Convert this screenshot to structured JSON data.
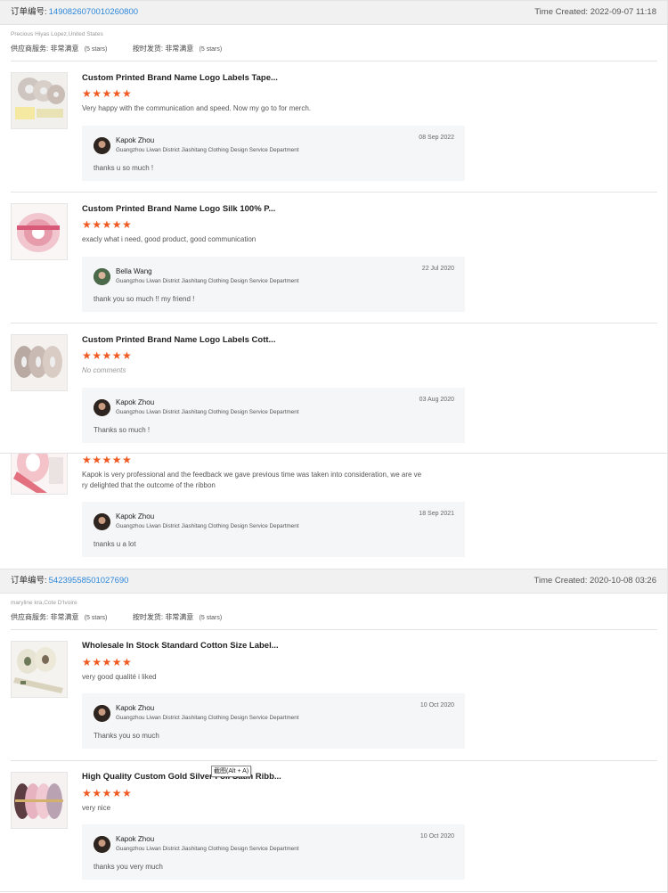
{
  "orders": [
    {
      "order_label": "订单编号:",
      "order_number": "1490826070010260800",
      "time_created": "Time Created: 2022-09-07 11:18",
      "buyer": "Precious Hiyas Lopez,United States",
      "supplier_service_label": "供应商服务:",
      "supplier_service_value": "非常满意",
      "supplier_service_stars": "(5 stars)",
      "on_time_label": "按时发货:",
      "on_time_value": "非常满意",
      "on_time_stars": "(5 stars)",
      "items": [
        {
          "title": "Custom Printed Brand Name Logo Labels Tape...",
          "stars": "★★★★★",
          "rating": 5,
          "comment": "Very happy with the communication and speed. Now my go to for merch.",
          "reply": {
            "name": "Kapok Zhou",
            "company": "Guangzhou Liwan District Jiashitang Clothing Design Service Department",
            "date": "08 Sep 2022",
            "text": "thanks u so much !"
          }
        },
        {
          "title": "Custom Printed Brand Name Logo Silk 100% P...",
          "stars": "★★★★★",
          "rating": 5,
          "comment": "exacly what i need, good product, good communication",
          "reply": {
            "name": "Bella Wang",
            "company": "Guangzhou Liwan District Jiashitang Clothing Design Service Department",
            "date": "22 Jul 2020",
            "text": "thank you so much !! my friend !"
          }
        },
        {
          "title": "Custom Printed Brand Name Logo Labels Cott...",
          "stars": "★★★★★",
          "rating": 5,
          "comment": "No comments",
          "reply": {
            "name": "Kapok Zhou",
            "company": "Guangzhou Liwan District Jiashitang Clothing Design Service Department",
            "date": "03 Aug 2020",
            "text": "Thanks so much !"
          }
        },
        {
          "title": "",
          "stars": "★★★★★",
          "rating": 5,
          "comment_line1": "Kapok is very professional and the feedback we gave previous time was taken into consideration, we are ve",
          "comment_line2": "ry delighted that the outcome of the ribbon",
          "reply": {
            "name": "Kapok Zhou",
            "company": "Guangzhou Liwan District Jiashitang Clothing Design Service Department",
            "date": "18 Sep 2021",
            "text": "tnanks u a lot"
          }
        }
      ]
    },
    {
      "order_label": "订单编号:",
      "order_number": "54239558501027690",
      "time_created": "Time Created: 2020-10-08 03:26",
      "buyer": "maryline kra,Cote D'Ivoire",
      "supplier_service_label": "供应商服务:",
      "supplier_service_value": "非常满意",
      "supplier_service_stars": "(5 stars)",
      "on_time_label": "按时发货:",
      "on_time_value": "非常满意",
      "on_time_stars": "(5 stars)",
      "items": [
        {
          "title": "Wholesale In Stock Standard Cotton Size Label...",
          "stars": "★★★★★",
          "rating": 5,
          "comment": "very good qualité i liked",
          "reply": {
            "name": "Kapok Zhou",
            "company": "Guangzhou Liwan District Jiashitang Clothing Design Service Department",
            "date": "10 Oct 2020",
            "text": "Thanks you so much"
          }
        },
        {
          "title": "High Quality Custom Gold Silver Foil Satin Ribb...",
          "stars": "★★★★★",
          "rating": 5,
          "comment": "very nice",
          "reply": {
            "name": "Kapok Zhou",
            "company": "Guangzhou Liwan District Jiashitang Clothing Design Service Department",
            "date": "10 Oct 2020",
            "text": "thanks you very much"
          }
        }
      ]
    }
  ],
  "tooltip": "截图(Alt + A)",
  "colors": {
    "accent_star": "#f05a22",
    "link_blue": "#2d87d8",
    "header_bg": "#f1f1f2",
    "reply_bg": "#f5f6f7"
  }
}
